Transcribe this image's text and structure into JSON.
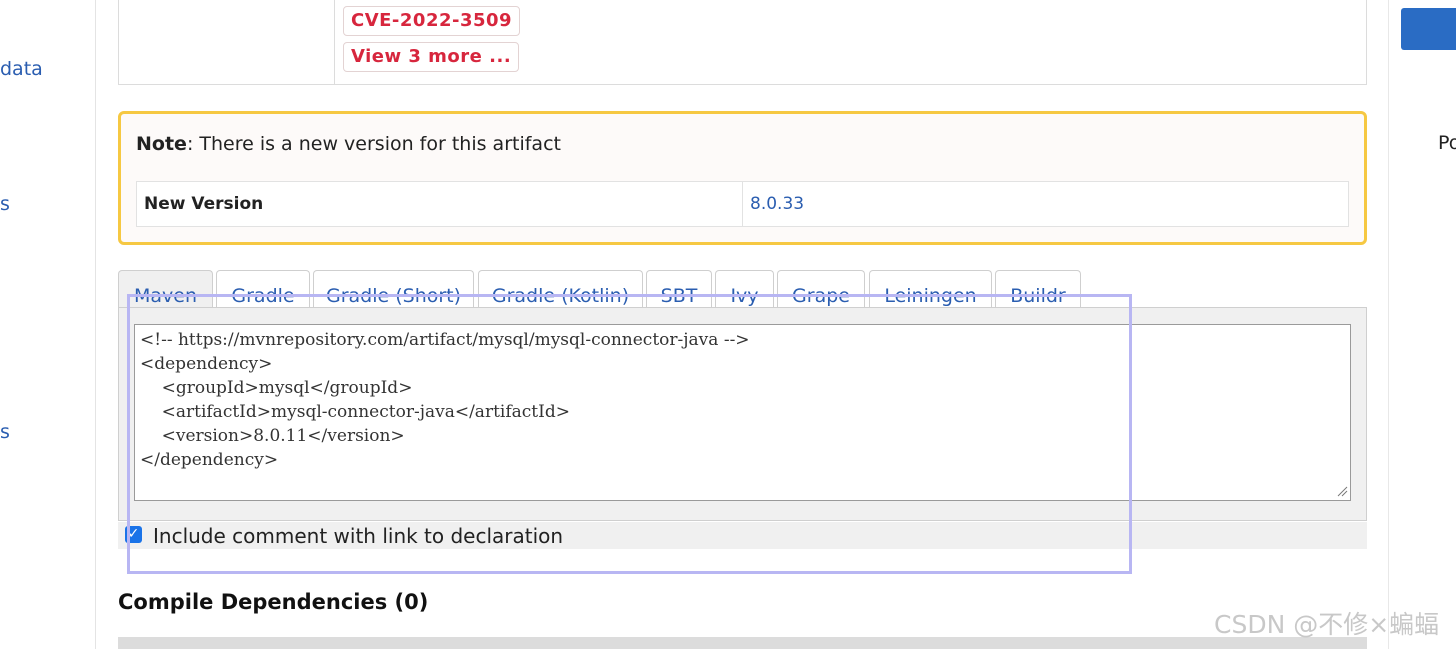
{
  "left_sidebar": {
    "links": [
      "data",
      "s",
      "s"
    ]
  },
  "right_sidebar": {
    "partial_text": "Po"
  },
  "vulnerabilities": {
    "badges": [
      "CVE-2022-3509",
      "View 3 more ..."
    ],
    "badge_color": "#d7263d"
  },
  "note": {
    "label": "Note",
    "text": ": There is a new version for this artifact",
    "new_version_label": "New Version",
    "new_version_value": "8.0.33",
    "border_color": "#f6c842"
  },
  "tabs": [
    "Maven",
    "Gradle",
    "Gradle (Short)",
    "Gradle (Kotlin)",
    "SBT",
    "Ivy",
    "Grape",
    "Leiningen",
    "Buildr"
  ],
  "active_tab": "Maven",
  "code_snippet": "<!-- https://mvnrepository.com/artifact/mysql/mysql-connector-java -->\n<dependency>\n    <groupId>mysql</groupId>\n    <artifactId>mysql-connector-java</artifactId>\n    <version>8.0.11</version>\n</dependency>",
  "include_comment": {
    "checked": true,
    "label": "Include comment with link to declaration"
  },
  "compile_dependencies_title": "Compile Dependencies (0)",
  "watermark": "CSDN @不修×蝙蝠",
  "colors": {
    "link": "#2a5db0",
    "accent_button": "#2a6cc4",
    "highlight_box": "#b8b6f3"
  }
}
